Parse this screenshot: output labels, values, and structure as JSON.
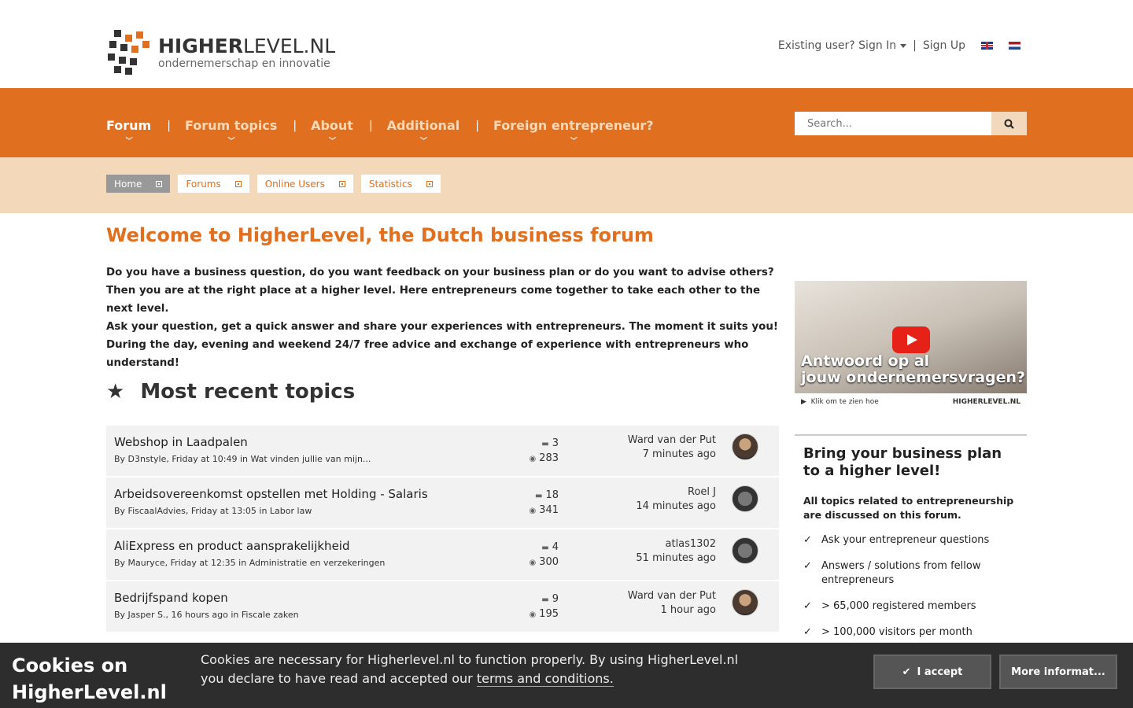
{
  "header": {
    "logo_title_bold": "HIGHER",
    "logo_title_rest": "LEVEL.NL",
    "logo_subtitle": "ondernemerschap en innovatie",
    "sign_in": "Existing user? Sign In",
    "separator": "|",
    "sign_up": "Sign Up"
  },
  "nav": {
    "items": [
      {
        "label": "Forum"
      },
      {
        "label": "Forum topics"
      },
      {
        "label": "About"
      },
      {
        "label": "Additional"
      },
      {
        "label": "Foreign entrepreneur?"
      }
    ],
    "separator": "|",
    "search_placeholder": "Search..."
  },
  "breadcrumbs": [
    {
      "label": "Home"
    },
    {
      "label": "Forums"
    },
    {
      "label": "Online Users"
    },
    {
      "label": "Statistics"
    }
  ],
  "main": {
    "title": "Welcome to HigherLevel, the Dutch business forum",
    "intro": [
      "Do you have a business question, do you want feedback on your business plan or do you want to advise others? Then you are at the right place at a higher level. Here entrepreneurs come together to take each other to the next level.",
      "Ask your question, get a quick answer and share your experiences with entrepreneurs. The moment it suits you!",
      "During the day, evening and weekend 24/7 free advice and exchange of experience with entrepreneurs who understand!"
    ],
    "section_title": "Most recent topics"
  },
  "topics": [
    {
      "title": "Webshop in Laadpalen",
      "meta": "By D3nstyle, Friday at 10:49 in Wat vinden jullie van mijn...",
      "replies": "3",
      "views": "283",
      "last_user": "Ward van der Put",
      "last_time": "7 minutes ago"
    },
    {
      "title": "Arbeidsovereenkomst opstellen met Holding - Salaris",
      "meta": "By FiscaalAdvies, Friday at 13:05 in Labor law",
      "replies": "18",
      "views": "341",
      "last_user": "Roel J",
      "last_time": "14 minutes ago"
    },
    {
      "title": "AliExpress en product aansprakelijkheid",
      "meta": "By Mauryce, Friday at 12:35 in Administratie en verzekeringen",
      "replies": "4",
      "views": "300",
      "last_user": "atlas1302",
      "last_time": "51 minutes ago"
    },
    {
      "title": "Bedrijfspand kopen",
      "meta": "By Jasper S., 16 hours ago in Fiscale zaken",
      "replies": "9",
      "views": "195",
      "last_user": "Ward van der Put",
      "last_time": "1 hour ago"
    }
  ],
  "sidebar": {
    "video_text_1": "Antwoord op al",
    "video_text_2": "jouw ondernemersvragen?",
    "video_caption": "Klik om te zien hoe",
    "video_brand": "HIGHERLEVEL.NL",
    "promo_title": "Bring your business plan to a higher level!",
    "promo_lead": "All topics related to entrepreneurship are discussed on this forum.",
    "check_mark": "✓",
    "promo_items": [
      "Ask your entrepreneur questions",
      "Answers / solutions from fellow entrepreneurs",
      "> 65,000 registered members",
      "> 100,000 visitors per month"
    ]
  },
  "cookie": {
    "title": "Cookies on HigherLevel.nl",
    "text": "Cookies are necessary for Higherlevel.nl to function properly. By using HigherLevel.nl you declare to have read and accepted our ",
    "link": "terms and conditions.",
    "accept": "I accept",
    "more": "More informat..."
  },
  "colors": {
    "brand_orange": "#e07020",
    "crumb_band": "#f3d8ba",
    "cookie_bg": "#2d2d2d"
  }
}
